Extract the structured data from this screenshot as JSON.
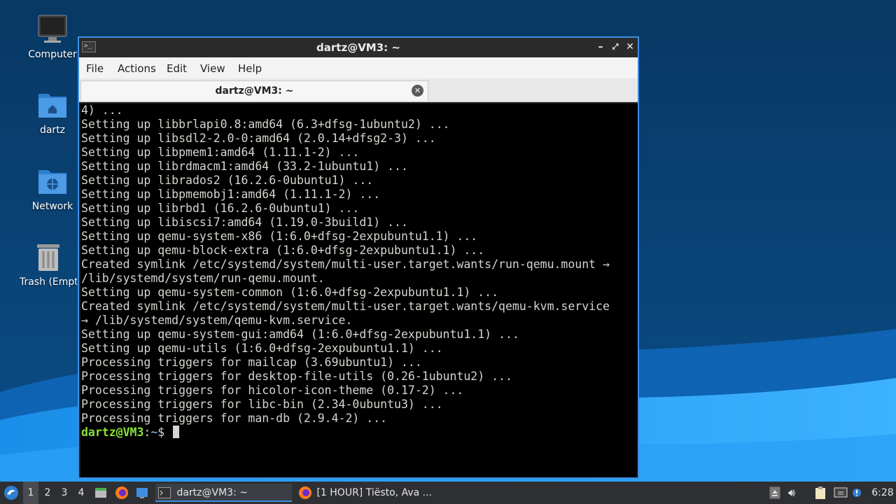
{
  "desktop": {
    "icons": [
      {
        "label": "Computer",
        "icon": "computer-icon"
      },
      {
        "label": "dartz",
        "icon": "home-folder-icon"
      },
      {
        "label": "Network",
        "icon": "network-folder-icon"
      },
      {
        "label": "Trash (Empty)",
        "icon": "trash-icon"
      }
    ]
  },
  "window": {
    "title": "dartz@VM3: ~",
    "menu": [
      "File",
      "Actions",
      "Edit",
      "View",
      "Help"
    ],
    "tab_label": "dartz@VM3: ~",
    "terminal_lines": [
      "4) ...",
      "Setting up libbrlapi0.8:amd64 (6.3+dfsg-1ubuntu2) ...",
      "Setting up libsdl2-2.0-0:amd64 (2.0.14+dfsg2-3) ...",
      "Setting up libpmem1:amd64 (1.11.1-2) ...",
      "Setting up librdmacm1:amd64 (33.2-1ubuntu1) ...",
      "Setting up librados2 (16.2.6-0ubuntu1) ...",
      "Setting up libpmemobj1:amd64 (1.11.1-2) ...",
      "Setting up librbd1 (16.2.6-0ubuntu1) ...",
      "Setting up libiscsi7:amd64 (1.19.0-3build1) ...",
      "Setting up qemu-system-x86 (1:6.0+dfsg-2expubuntu1.1) ...",
      "Setting up qemu-block-extra (1:6.0+dfsg-2expubuntu1.1) ...",
      "Created symlink /etc/systemd/system/multi-user.target.wants/run-qemu.mount →",
      "/lib/systemd/system/run-qemu.mount.",
      "Setting up qemu-system-common (1:6.0+dfsg-2expubuntu1.1) ...",
      "Created symlink /etc/systemd/system/multi-user.target.wants/qemu-kvm.service",
      "→ /lib/systemd/system/qemu-kvm.service.",
      "Setting up qemu-system-gui:amd64 (1:6.0+dfsg-2expubuntu1.1) ...",
      "Setting up qemu-utils (1:6.0+dfsg-2expubuntu1.1) ...",
      "Processing triggers for mailcap (3.69ubuntu1) ...",
      "Processing triggers for desktop-file-utils (0.26-1ubuntu2) ...",
      "Processing triggers for hicolor-icon-theme (0.17-2) ...",
      "Processing triggers for libc-bin (2.34-0ubuntu3) ...",
      "Processing triggers for man-db (2.9.4-2) ..."
    ],
    "prompt": {
      "user_host": "dartz@VM3",
      "sep": ":",
      "path": "~",
      "symbol": "$ "
    }
  },
  "taskbar": {
    "workspaces": [
      "1",
      "2",
      "3",
      "4"
    ],
    "active_workspace": "1",
    "tasks": [
      {
        "label": "dartz@VM3: ~",
        "icon": "terminal-icon"
      },
      {
        "label": "[1 HOUR] Tiësto, Ava ...",
        "icon": "firefox-icon"
      }
    ],
    "clock": "6:28"
  },
  "colors": {
    "accent": "#3d8ee0",
    "terminal_bg": "#000000",
    "prompt_user": "#8ae234",
    "prompt_path": "#729fcf"
  }
}
